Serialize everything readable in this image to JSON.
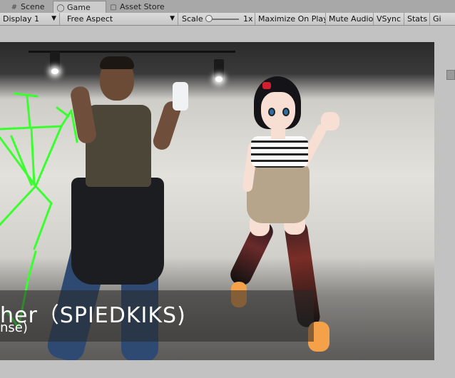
{
  "tabs": [
    {
      "label": "Scene",
      "icon": "scene-icon",
      "active": false
    },
    {
      "label": "Game",
      "icon": "game-controller-icon",
      "active": true
    },
    {
      "label": "Asset Store",
      "icon": "asset-store-icon",
      "active": false
    }
  ],
  "toolbar": {
    "display": "Display 1",
    "aspect": "Free Aspect",
    "scale_label": "Scale",
    "scale_value": "1x",
    "scale_level": 0.0,
    "maximize": "Maximize On Play",
    "mute": "Mute Audio",
    "vsync": "VSync",
    "stats": "Stats",
    "gizmos": "Gi"
  },
  "viewport": {
    "caption_main": "her（SPIEDKIKS)",
    "caption_sub": "nse)"
  },
  "colors": {
    "skeleton": "#3aff2e",
    "tab_active": "#cbcbcb"
  }
}
